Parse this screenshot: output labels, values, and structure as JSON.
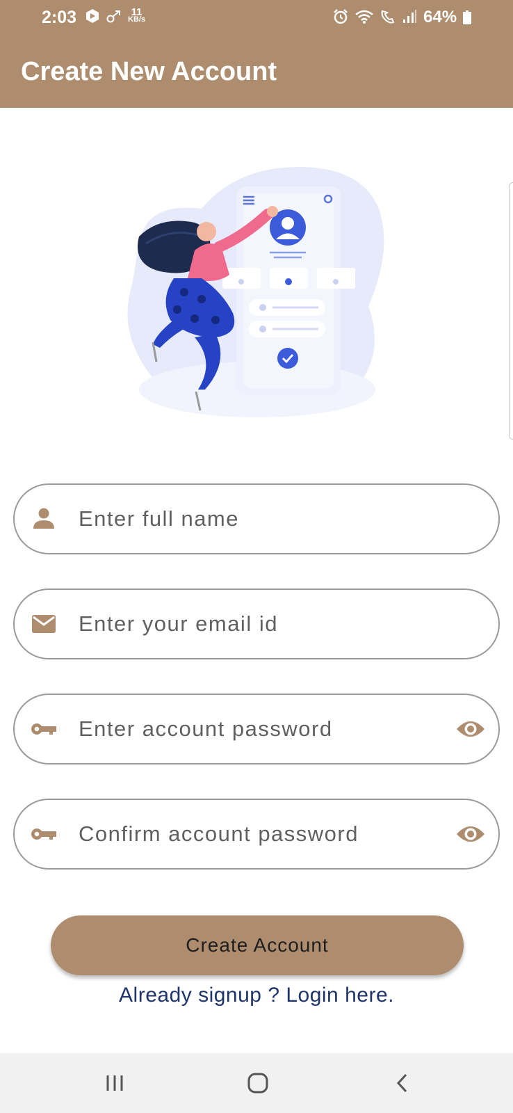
{
  "status_bar": {
    "time": "2:03",
    "net_speed_value": "11",
    "net_speed_unit": "KB/s",
    "battery": "64%"
  },
  "header": {
    "title": "Create New Account"
  },
  "form": {
    "full_name": {
      "placeholder": "Enter full name",
      "icon": "person-icon"
    },
    "email": {
      "placeholder": "Enter your email id",
      "icon": "mail-icon"
    },
    "password": {
      "placeholder": "Enter account password",
      "icon": "key-icon",
      "toggle_icon": "eye-icon"
    },
    "confirm_password": {
      "placeholder": "Confirm account password",
      "icon": "key-icon",
      "toggle_icon": "eye-icon"
    },
    "submit_label": "Create Account",
    "login_link": "Already signup ? Login here."
  },
  "colors": {
    "accent": "#ae8d6f",
    "link": "#1f3468",
    "field_border": "#9a9a9a"
  }
}
